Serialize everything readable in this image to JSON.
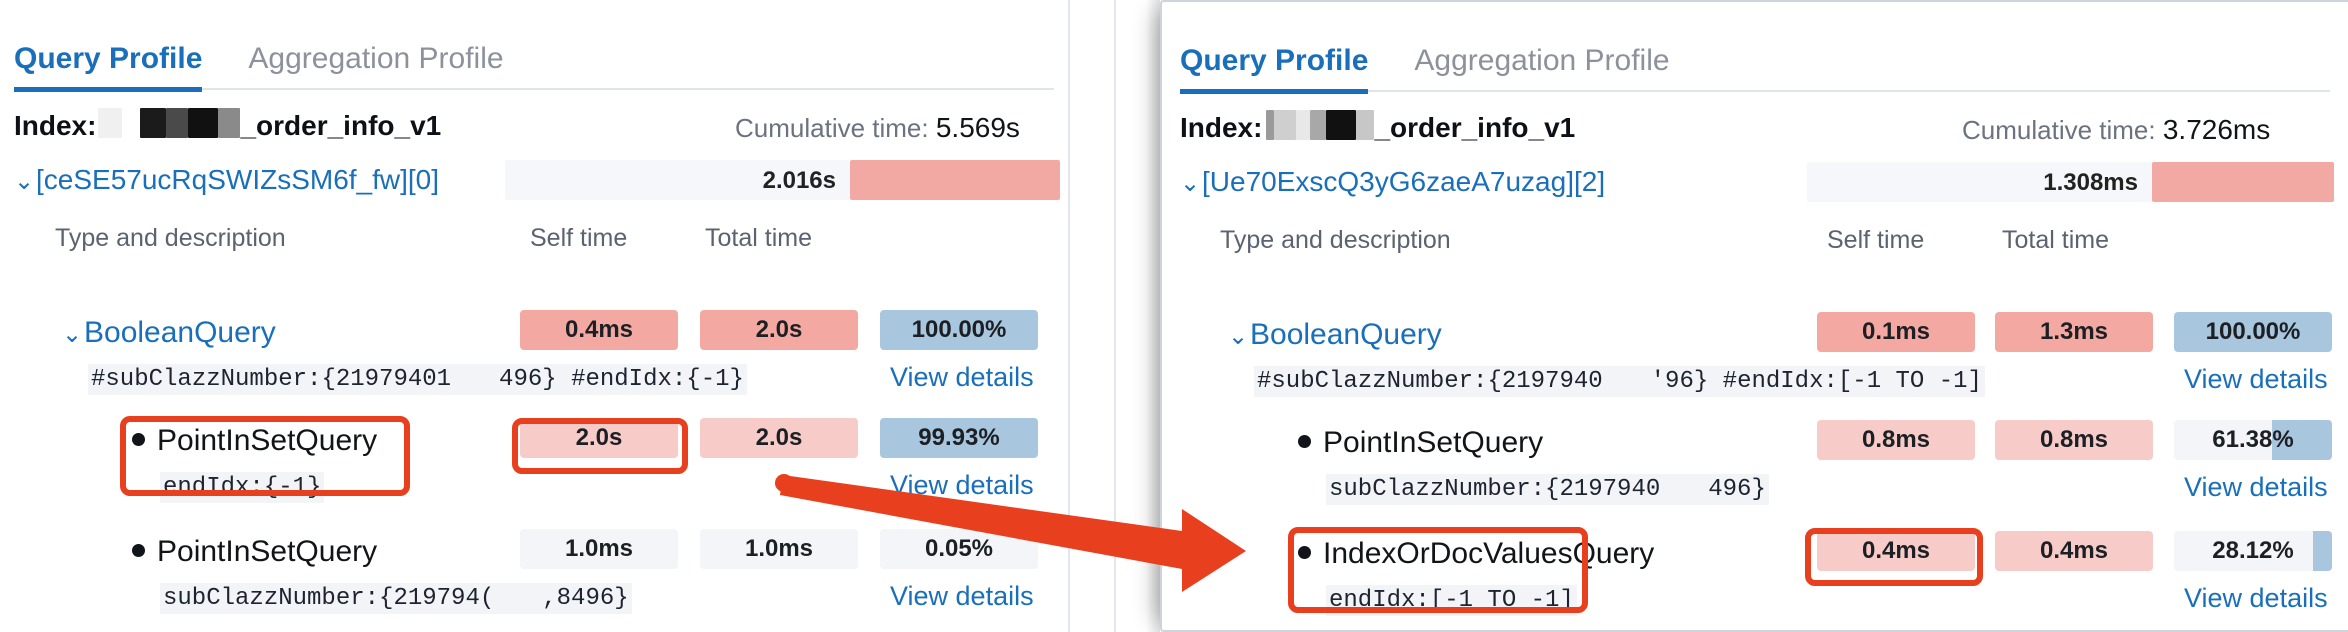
{
  "colors": {
    "accent_blue": "#1a6fba",
    "annotation_red": "#e8401f",
    "pill_red": "#f3a8a2",
    "pill_red_light": "#f7ccc8",
    "pill_blue": "#a8c6dd",
    "pill_grey": "#f3f5f8"
  },
  "left_panel": {
    "tabs": [
      {
        "label": "Query Profile",
        "active": true
      },
      {
        "label": "Aggregation Profile",
        "active": false
      }
    ],
    "index": {
      "label": "Index:",
      "name_suffix": "_order_info_v1",
      "redacted": true
    },
    "cumulative": {
      "label": "Cumulative time:",
      "value": "5.569s"
    },
    "shard": {
      "id": "[ceSE57ucRqSWIZsSM6f_fw][0]",
      "time": "2.016s"
    },
    "columns": {
      "type": "Type and description",
      "self": "Self time",
      "total": "Total time"
    },
    "view_details": "View details",
    "nodes": [
      {
        "title": "BooleanQuery",
        "kind": "branch",
        "description": "#subClazzNumber:{21979401  496} #endIdx:{-1}",
        "self_time": "0.4ms",
        "total_time": "2.0s",
        "percent": "100.00%",
        "percent_fill": 100,
        "self_style": "red",
        "total_style": "red",
        "view_details": "View details"
      },
      {
        "title": "PointInSetQuery",
        "kind": "leaf",
        "description": "endIdx:{-1}",
        "self_time": "2.0s",
        "total_time": "2.0s",
        "percent": "99.93%",
        "percent_fill": 100,
        "self_style": "redlt",
        "total_style": "redlt",
        "view_details": "View details"
      },
      {
        "title": "PointInSetQuery",
        "kind": "leaf",
        "description": "subClazzNumber:{219794(  ,8496}",
        "self_time": "1.0ms",
        "total_time": "1.0ms",
        "percent": "0.05%",
        "percent_fill": 0,
        "self_style": "grey",
        "total_style": "grey",
        "view_details": "View details"
      }
    ]
  },
  "right_panel": {
    "tabs": [
      {
        "label": "Query Profile",
        "active": true
      },
      {
        "label": "Aggregation Profile",
        "active": false
      }
    ],
    "index": {
      "label": "Index:",
      "name_suffix": "_order_info_v1",
      "redacted": true
    },
    "cumulative": {
      "label": "Cumulative time:",
      "value": "3.726ms"
    },
    "shard": {
      "id": "[Ue70ExscQ3yG6zaeA7uzag][2]",
      "time": "1.308ms"
    },
    "columns": {
      "type": "Type and description",
      "self": "Self time",
      "total": "Total time"
    },
    "view_details": "View details",
    "nodes": [
      {
        "title": "BooleanQuery",
        "kind": "branch",
        "description": "#subClazzNumber:{2197940  '96} #endIdx:[-1 TO -1]",
        "self_time": "0.1ms",
        "total_time": "1.3ms",
        "percent": "100.00%",
        "percent_fill": 100,
        "self_style": "red",
        "total_style": "red",
        "view_details": "View details"
      },
      {
        "title": "PointInSetQuery",
        "kind": "leaf",
        "description": "subClazzNumber:{2197940  496}",
        "self_time": "0.8ms",
        "total_time": "0.8ms",
        "percent": "61.38%",
        "percent_fill": 38,
        "self_style": "redlt",
        "total_style": "redlt",
        "view_details": "View details"
      },
      {
        "title": "IndexOrDocValuesQuery",
        "kind": "leaf",
        "description": "endIdx:[-1 TO -1]",
        "self_time": "0.4ms",
        "total_time": "0.4ms",
        "percent": "28.12%",
        "percent_fill": 12,
        "self_style": "redlt",
        "total_style": "redlt",
        "view_details": "View details"
      }
    ]
  },
  "annotations": {
    "highlight_count": 4,
    "arrow": {
      "color": "#e8401f",
      "direction": "left-to-right"
    }
  }
}
